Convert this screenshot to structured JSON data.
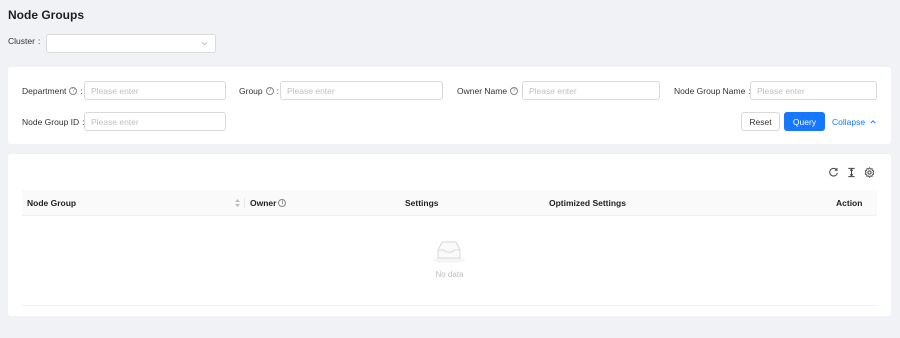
{
  "page": {
    "title": "Node Groups"
  },
  "cluster": {
    "label": "Cluster",
    "value": ""
  },
  "filters": {
    "department": {
      "label": "Department",
      "placeholder": "Please enter"
    },
    "group": {
      "label": "Group",
      "placeholder": "Please enter"
    },
    "owner_name": {
      "label": "Owner Name",
      "placeholder": "Please enter"
    },
    "node_group_name": {
      "label": "Node Group Name",
      "placeholder": "Please enter"
    },
    "node_group_id": {
      "label": "Node Group ID",
      "placeholder": "Please enter"
    }
  },
  "actions": {
    "reset": "Reset",
    "query": "Query",
    "collapse": "Collapse"
  },
  "toolbar": {
    "icons": [
      "reload-icon",
      "column-height-icon",
      "setting-icon"
    ]
  },
  "table": {
    "columns": [
      "Node Group",
      "Owner",
      "Settings",
      "Optimized Settings",
      "Action"
    ],
    "rows": [],
    "empty_text": "No data"
  },
  "colors": {
    "primary": "#1677ff",
    "background": "#f0f2f5",
    "border": "#d9d9d9",
    "placeholder": "#bfbfbf"
  }
}
